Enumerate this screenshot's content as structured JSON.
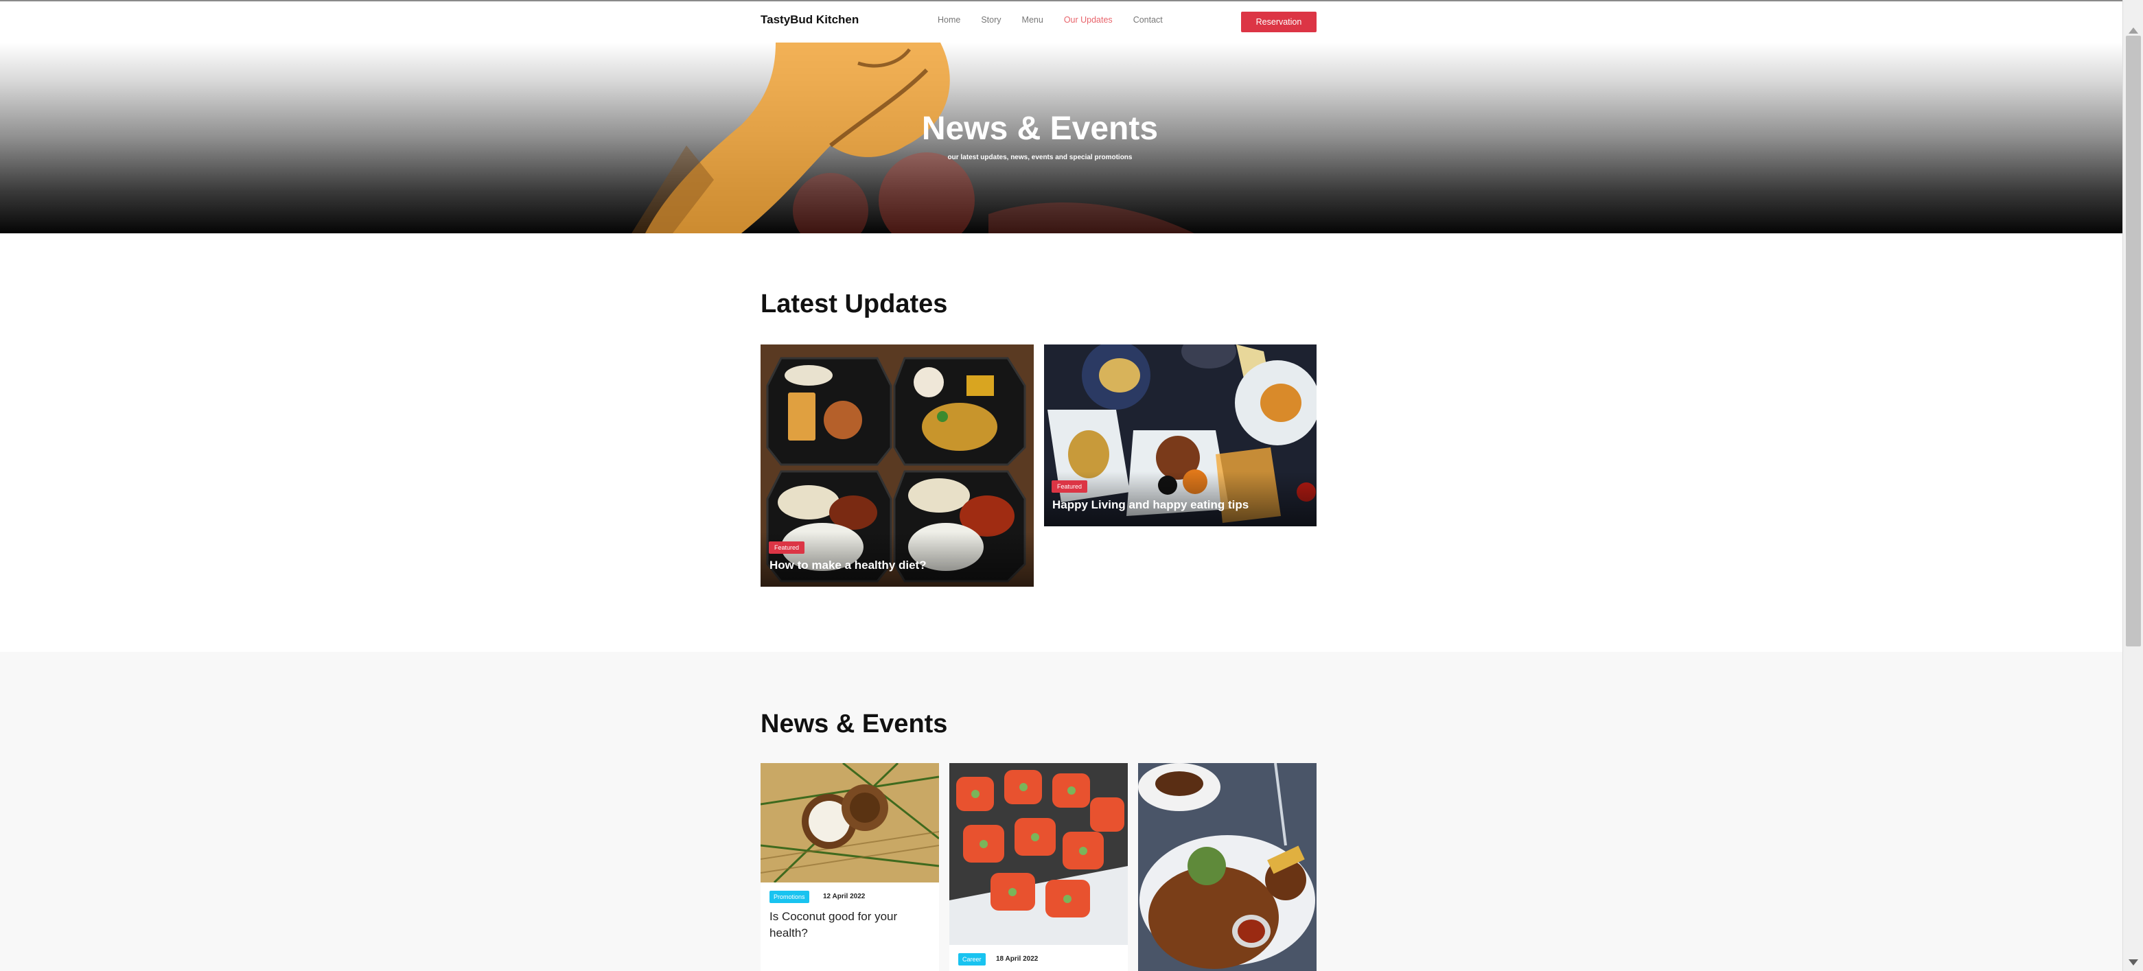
{
  "nav": {
    "brand": "TastyBud Kitchen",
    "links": [
      "Home",
      "Story",
      "Menu",
      "Our Updates",
      "Contact"
    ],
    "active_link": "Our Updates",
    "reservation_label": "Reservation"
  },
  "hero": {
    "title": "News & Events",
    "subtitle": "our latest updates, news, events and special promotions"
  },
  "latest": {
    "title": "Latest Updates",
    "cards": [
      {
        "badge": "Featured",
        "title": "How to make a healthy diet?"
      },
      {
        "badge": "Featured",
        "title": "Happy Living and happy eating tips"
      }
    ]
  },
  "news": {
    "title": "News & Events",
    "cards": [
      {
        "category": "Promotions",
        "date": "12 April 2022",
        "title": "Is Coconut good for your health?"
      },
      {
        "category": "Career",
        "date": "18 April 2022",
        "title": ""
      },
      {
        "category": "",
        "date": "",
        "title": ""
      }
    ]
  },
  "colors": {
    "accent": "#dc3545",
    "active_link": "#e8646b",
    "category_badge": "#19c3f0"
  },
  "icons": [
    "scroll-up-arrow-icon",
    "scroll-down-arrow-icon"
  ]
}
